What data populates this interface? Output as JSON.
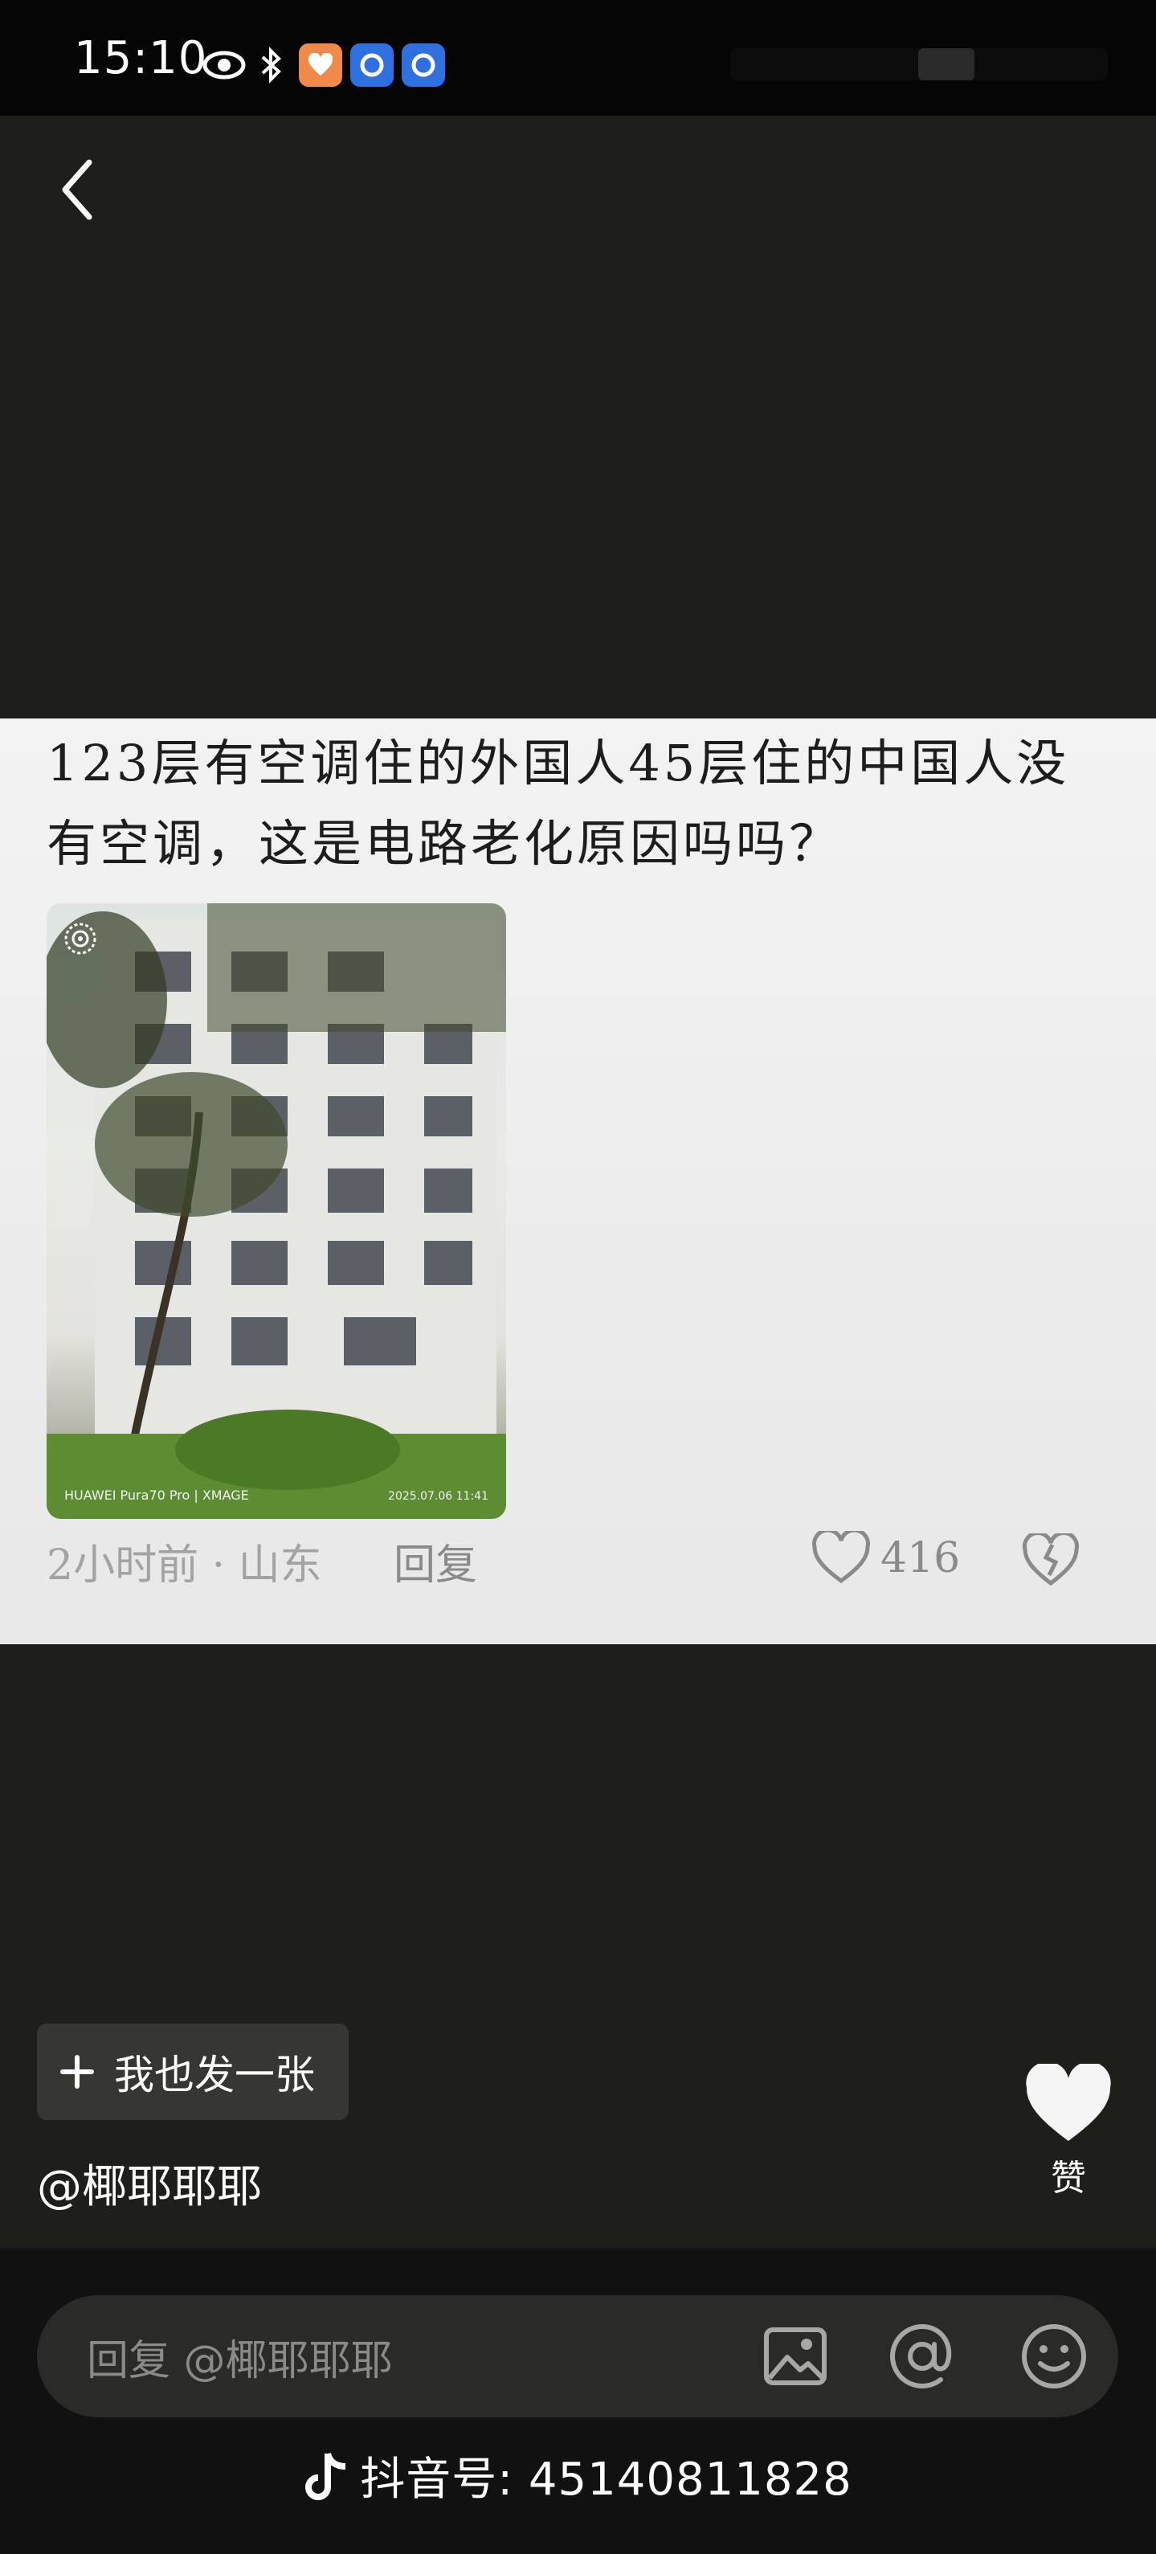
{
  "status_bar": {
    "time": "15:10",
    "icons": [
      "eye-icon",
      "bluetooth-icon",
      "app-badge-icon",
      "app-ring-icon",
      "app-ring-icon"
    ]
  },
  "comment": {
    "text": "123层有空调住的外国人45层住的中国人没有空调，这是电路老化原因吗吗？",
    "time_location": "2小时前 · 山东",
    "reply_label": "回复",
    "like_count": "416",
    "photo": {
      "brand": "HUAWEI Pura70 Pro | XMAGE",
      "date": "2025.07.06 11:41"
    }
  },
  "actions": {
    "post_button_label": "我也发一张",
    "author": "@椰耶耶耶",
    "like_label": "赞"
  },
  "reply_bar": {
    "placeholder": "回复 @椰耶耶耶"
  },
  "watermark": {
    "text": "抖音号: 45140811828"
  },
  "colors": {
    "background": "#1e1e1a",
    "card": "#f0f0f0",
    "accent_orange": "#f08a4b",
    "accent_blue": "#2f6fe0"
  }
}
